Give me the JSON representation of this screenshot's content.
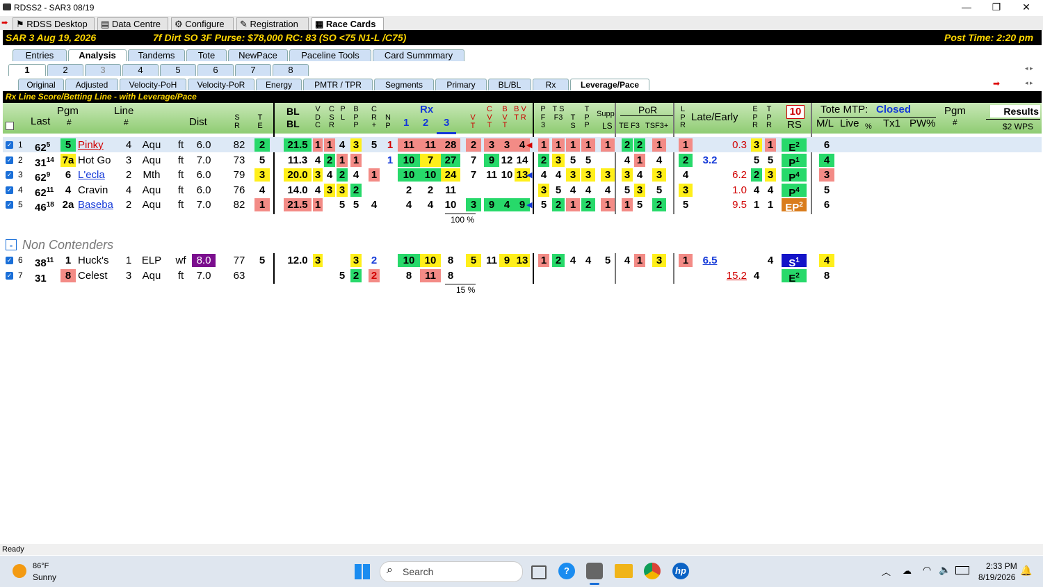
{
  "window": {
    "title": "RDSS2 - SAR3  08/19",
    "min": "—",
    "max": "❐",
    "close": "✕"
  },
  "top_tabs": [
    "RDSS Desktop",
    "Data Centre",
    "Configure",
    "Registration",
    "Race Cards"
  ],
  "race": {
    "info": "SAR  3   Aug 19, 2026",
    "conditions": "7f  Dirt   SO  3F   Purse: $78,000   RC: 83  (SO <75 N1-L /C75)",
    "post_time": "Post Time: 2:20 pm"
  },
  "section_tabs": [
    "Entries",
    "Analysis",
    "Tandems",
    "Tote",
    "NewPace",
    "Paceline Tools",
    "Card Summmary"
  ],
  "race_numbers": [
    "1",
    "2",
    "3",
    "4",
    "5",
    "6",
    "7",
    "8"
  ],
  "view_tabs": [
    "Original",
    "Adjusted",
    "Velocity-PoH",
    "Velocity-PoR",
    "Energy",
    "PMTR / TPR",
    "Segments",
    "Primary",
    "BL/BL",
    "Rx",
    "Leverage/Pace"
  ],
  "subtitle": "Rx Line Score/Betting Line - with Leverage/Pace",
  "headers": {
    "last": "Last",
    "pgm": "Pgm",
    "pgm_hash": "#",
    "line": "Line",
    "line_hash": "#",
    "dist": "Dist",
    "sr": "S R",
    "te": "T E",
    "bl": "BL",
    "bl2": "BL",
    "vdc": "V D C",
    "csr": "C S R",
    "pl": "P L",
    "bpp": "B P P",
    "cr": "C R +",
    "np": "N P",
    "rx": "Rx",
    "rx1": "1",
    "rx2": "2",
    "rx3": "3",
    "vt": "V T",
    "cvt": "C V T",
    "bvt": "B V T",
    "bvtr": "B V T R",
    "pf3": "P F 3",
    "tsf3": "T S F3",
    "ts": "T S",
    "tpp": "T P P",
    "supp": "Supp.",
    "ls": "LS",
    "por": "PoR",
    "te_f3": "TE F3",
    "tsf3p": "TSF3+",
    "lpr": "L P R",
    "late_early": "Late/Early",
    "epr": "E P R",
    "tpr": "T P R",
    "rs_num": "10",
    "rs": "RS",
    "tote_mtp": "Tote MTP:",
    "tote_status": "Closed",
    "ml": "M/L",
    "live": "Live",
    "pct": "%",
    "tx1": "Tx1",
    "pw": "PW%",
    "pgm2": "Pgm",
    "pgm2_hash": "#",
    "results": "Results",
    "wps": "$2 WPS"
  },
  "contenders": [
    {
      "n": "1",
      "last": "62",
      "lsup": "5",
      "pgm": "5",
      "name": "Pinky",
      "line": "4",
      "trk": "Aqu",
      "sfc": "ft",
      "dist": "6.0",
      "sr": "82",
      "te": "2",
      "bl": "21.5",
      "vdc": "1",
      "csr": "1",
      "pl": "4",
      "bpp": "3",
      "cr": "5",
      "np": "1",
      "rx1": "11",
      "rx2": "11",
      "rx3": "28",
      "vt": "2",
      "cvt": "3",
      "bvt": "3",
      "bvtr": "4",
      "pf3": "1",
      "tsf3": "1",
      "ts": "1",
      "tpp": "1",
      "ls": "1",
      "tef3a": "2",
      "tef3b": "2",
      "tsf3p": "1",
      "lpr": "1",
      "late": "",
      "early": "0.3",
      "epr": "3",
      "tpr": "1",
      "rs": "E",
      "rssup": "2",
      "ml": "6"
    },
    {
      "n": "2",
      "last": "31",
      "lsup": "14",
      "pgm": "7a",
      "name": "Hot Go",
      "line": "3",
      "trk": "Aqu",
      "sfc": "ft",
      "dist": "7.0",
      "sr": "73",
      "te": "5",
      "bl": "11.3",
      "vdc": "4",
      "csr": "2",
      "pl": "1",
      "bpp": "1",
      "cr": "",
      "np": "1",
      "rx1": "10",
      "rx2": "7",
      "rx3": "27",
      "vt": "7",
      "cvt": "9",
      "bvt": "12",
      "bvtr": "14",
      "pf3": "2",
      "tsf3": "3",
      "ts": "5",
      "tpp": "5",
      "ls": "",
      "tef3a": "4",
      "tef3b": "1",
      "tsf3p": "4",
      "lpr": "2",
      "late": "3.2",
      "early": "",
      "epr": "5",
      "tpr": "5",
      "rs": "P",
      "rssup": "1",
      "ml": "4"
    },
    {
      "n": "3",
      "last": "62",
      "lsup": "9",
      "pgm": "6",
      "name": "L'ecla",
      "line": "2",
      "trk": "Mth",
      "sfc": "ft",
      "dist": "6.0",
      "sr": "79",
      "te": "3",
      "bl": "20.0",
      "vdc": "3",
      "csr": "4",
      "pl": "2",
      "bpp": "4",
      "cr": "1",
      "np": "",
      "rx1": "10",
      "rx2": "10",
      "rx3": "24",
      "vt": "7",
      "cvt": "11",
      "bvt": "10",
      "bvtr": "13",
      "pf3": "4",
      "tsf3": "4",
      "ts": "3",
      "tpp": "3",
      "ls": "3",
      "tef3a": "3",
      "tef3b": "4",
      "tsf3p": "3",
      "lpr": "4",
      "late": "",
      "early": "6.2",
      "epr": "2",
      "tpr": "3",
      "rs": "P",
      "rssup": "4",
      "ml": "3"
    },
    {
      "n": "4",
      "last": "62",
      "lsup": "11",
      "pgm": "4",
      "name": "Cravin",
      "line": "4",
      "trk": "Aqu",
      "sfc": "ft",
      "dist": "6.0",
      "sr": "76",
      "te": "4",
      "bl": "14.0",
      "vdc": "4",
      "csr": "3",
      "pl": "3",
      "bpp": "2",
      "cr": "",
      "np": "",
      "rx1": "2",
      "rx2": "2",
      "rx3": "11",
      "vt": "",
      "cvt": "",
      "bvt": "",
      "bvtr": "",
      "pf3": "3",
      "tsf3": "5",
      "ts": "4",
      "tpp": "4",
      "ls": "4",
      "tef3a": "5",
      "tef3b": "3",
      "tsf3p": "5",
      "lpr": "3",
      "late": "",
      "early": "1.0",
      "epr": "4",
      "tpr": "4",
      "rs": "P",
      "rssup": "4",
      "ml": "5"
    },
    {
      "n": "5",
      "last": "46",
      "lsup": "18",
      "pgm": "2a",
      "name": "Baseba",
      "line": "2",
      "trk": "Aqu",
      "sfc": "ft",
      "dist": "7.0",
      "sr": "82",
      "te": "1",
      "bl": "21.5",
      "vdc": "1",
      "csr": "",
      "pl": "5",
      "bpp": "5",
      "cr": "4",
      "np": "",
      "rx1": "4",
      "rx2": "4",
      "rx3": "10",
      "vt": "3",
      "cvt": "9",
      "bvt": "4",
      "bvtr": "9",
      "pf3": "5",
      "tsf3": "2",
      "ts": "1",
      "tpp": "2",
      "ls": "1",
      "tef3a": "1",
      "tef3b": "5",
      "tsf3p": "2",
      "lpr": "5",
      "late": "",
      "early": "9.5",
      "epr": "1",
      "tpr": "1",
      "rs": "EP",
      "rssup": "2",
      "ml": "6"
    }
  ],
  "contenders_pct": "100 %",
  "non_contenders_label": "Non Contenders",
  "collapse": "-",
  "non_contenders": [
    {
      "n": "6",
      "last": "38",
      "lsup": "11",
      "pgm": "1",
      "name": "Huck's",
      "line": "1",
      "trk": "ELP",
      "sfc": "wf",
      "dist": "8.0",
      "sr": "77",
      "te": "5",
      "bl": "12.0",
      "vdc": "3",
      "pl": "",
      "bpp": "3",
      "cr": "2",
      "rx1": "10",
      "rx2": "10",
      "rx3": "8",
      "vt": "5",
      "cvt": "11",
      "bvt": "9",
      "bvtr": "13",
      "pf3": "1",
      "tsf3": "2",
      "ts": "4",
      "tpp": "4",
      "ls": "5",
      "tef3a": "4",
      "tef3b": "1",
      "tsf3p": "3",
      "lpr": "1",
      "late": "6.5",
      "early": "",
      "epr": "",
      "tpr": "4",
      "rs": "S",
      "rssup": "1",
      "ml": "4"
    },
    {
      "n": "7",
      "last": "31",
      "lsup": "",
      "pgm": "8",
      "name": "Celest",
      "line": "3",
      "trk": "Aqu",
      "sfc": "ft",
      "dist": "7.0",
      "sr": "63",
      "te": "",
      "bl": "",
      "vdc": "",
      "pl": "5",
      "bpp": "2",
      "cr": "2",
      "rx1": "8",
      "rx2": "11",
      "rx3": "8",
      "vt": "",
      "cvt": "",
      "bvt": "",
      "bvtr": "",
      "pf3": "",
      "tsf3": "",
      "ts": "",
      "tpp": "",
      "ls": "",
      "tef3a": "",
      "tef3b": "",
      "tsf3p": "",
      "lpr": "",
      "late": "",
      "early": "15.2",
      "epr": "4",
      "tpr": "",
      "rs": "E",
      "rssup": "2",
      "ml": "8"
    }
  ],
  "non_pct": "15 %",
  "status": "Ready",
  "taskbar": {
    "temp": "86°F",
    "weather": "Sunny",
    "search": "Search",
    "time": "2:33 PM",
    "date": "8/19/2026"
  }
}
